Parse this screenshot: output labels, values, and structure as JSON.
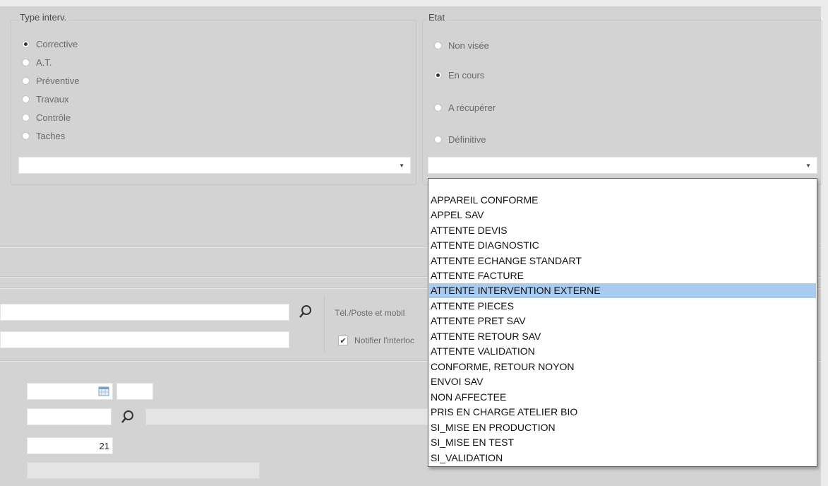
{
  "type_interv": {
    "title": "Type interv.",
    "options": [
      "Corrective",
      "A.T.",
      "Préventive",
      "Travaux",
      "Contrôle",
      "Taches"
    ],
    "selected": "Corrective",
    "select_value": ""
  },
  "etat": {
    "title": "Etat",
    "options": [
      "Non visée",
      "En cours",
      "A récupérer",
      "Définitive"
    ],
    "selected": "En cours",
    "select_value": ""
  },
  "contact": {
    "phone_label": "Tél./Poste et mobil",
    "notify_label": "Notifier l'interloc",
    "notify_checked": true
  },
  "bottom": {
    "number_value": "21"
  },
  "dropdown": {
    "items": [
      "",
      "APPAREIL CONFORME",
      "APPEL SAV",
      "ATTENTE DEVIS",
      "ATTENTE DIAGNOSTIC",
      "ATTENTE ECHANGE STANDART",
      "ATTENTE FACTURE",
      "ATTENTE INTERVENTION EXTERNE",
      "ATTENTE PIECES",
      "ATTENTE PRET SAV",
      "ATTENTE RETOUR SAV",
      "ATTENTE VALIDATION",
      "CONFORME, RETOUR NOYON",
      "ENVOI SAV",
      "NON AFFECTEE",
      "PRIS EN CHARGE ATELIER BIO",
      "SI_MISE EN PRODUCTION",
      "SI_MISE EN TEST",
      "SI_VALIDATION"
    ],
    "selected": "ATTENTE INTERVENTION EXTERNE"
  },
  "icons": {
    "search": "magnifier-icon",
    "calendar": "calendar-icon",
    "dropdown": "chevron-down-icon",
    "check": "checkmark-icon"
  }
}
